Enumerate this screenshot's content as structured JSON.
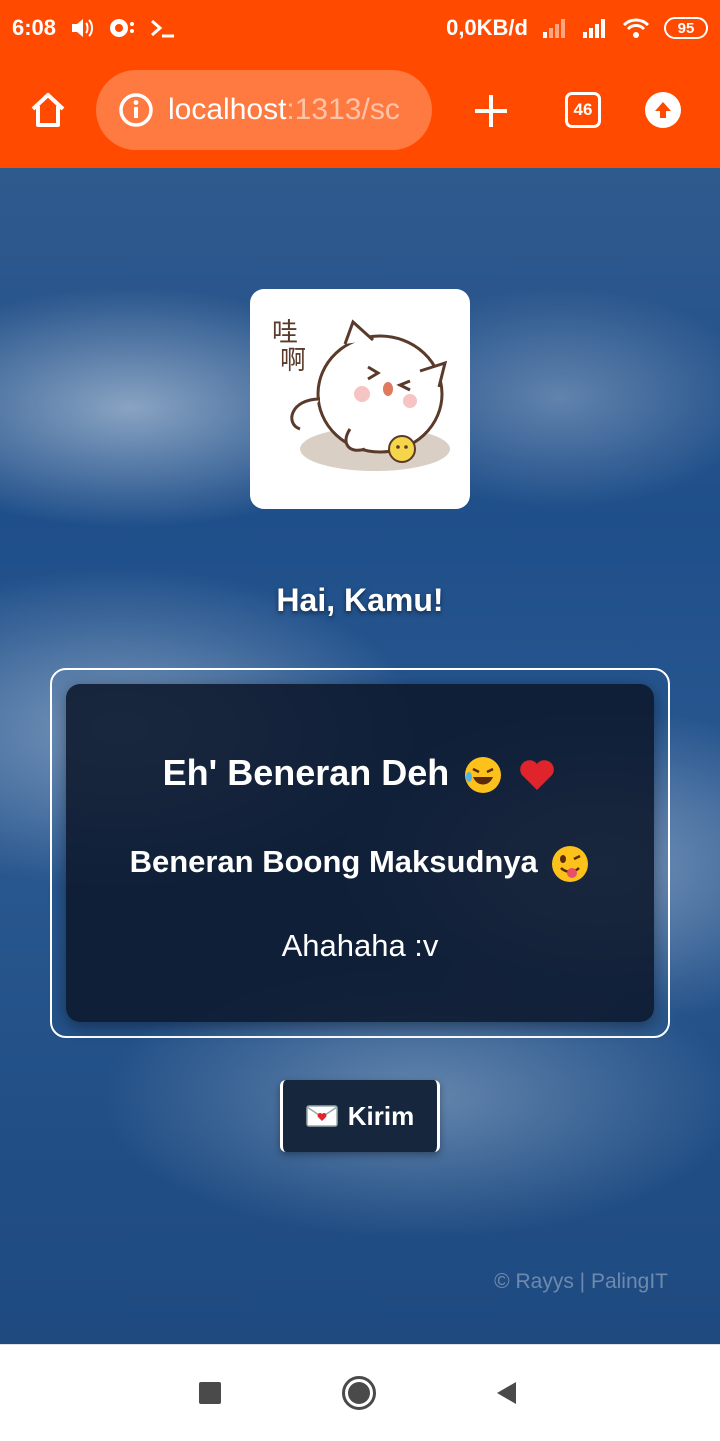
{
  "status_bar": {
    "time": "6:08",
    "net_speed": "0,0KB/d",
    "battery": "95"
  },
  "browser": {
    "url_host": "localhost",
    "url_rest": ":1313/sc",
    "tab_count": "46"
  },
  "page": {
    "greeting": "Hai, Kamu!",
    "message_line1": "Eh' Beneran Deh",
    "message_line2": "Beneran Boong Maksudnya",
    "message_line3": "Ahahaha :v",
    "send_button": "Kirim",
    "footer": "© Rayys | PalingIT"
  },
  "sticker": {
    "caption_chars": "哇啊"
  },
  "colors": {
    "toolbar": "#ff4a00",
    "url_pill": "#ff7a40",
    "card_bg": "#0c182c"
  },
  "icons": [
    "volume-icon",
    "notification-icon",
    "terminal-icon",
    "signal-icon",
    "wifi-icon",
    "battery-icon",
    "home-icon",
    "info-icon",
    "plus-icon",
    "tabs-icon",
    "upload-icon",
    "rofl-emoji-icon",
    "heart-emoji-icon",
    "wink-tongue-emoji-icon",
    "love-letter-icon"
  ]
}
